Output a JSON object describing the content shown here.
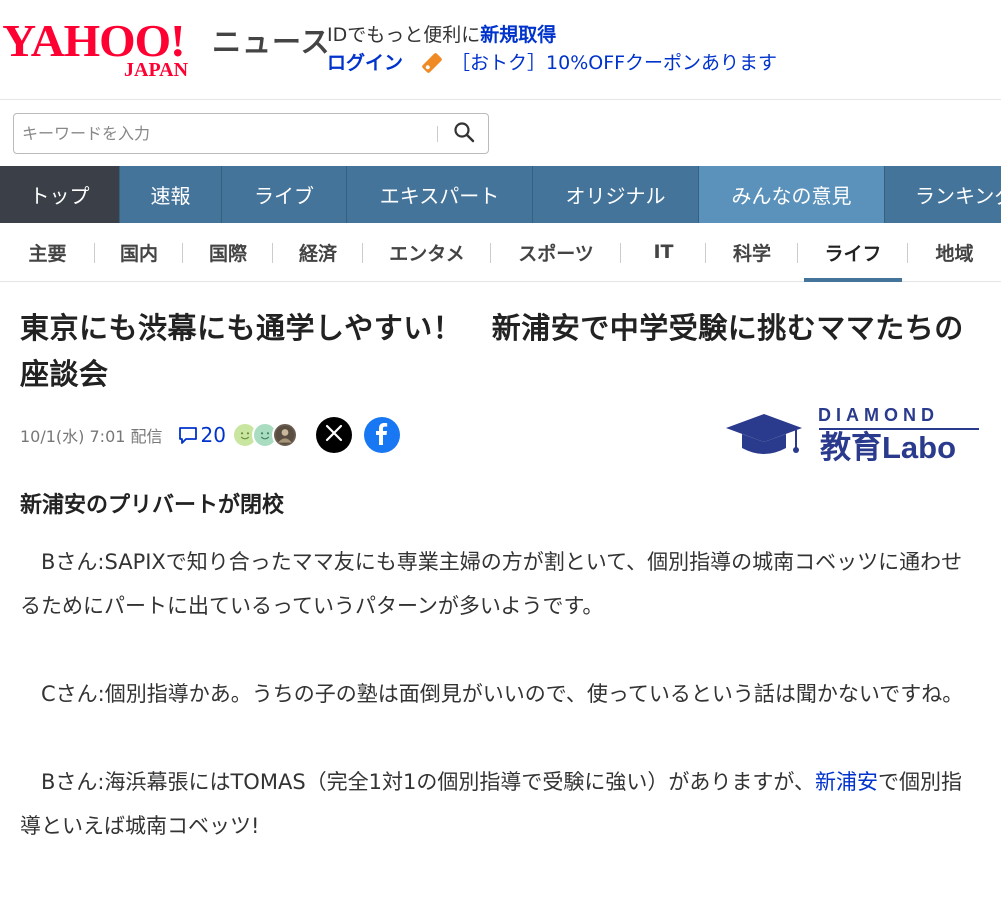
{
  "header": {
    "logo_main": "YAHOO!",
    "logo_sub": "JAPAN",
    "service_name": "ニュース",
    "promo_text": "IDでもっと便利に",
    "promo_link": "新規取得",
    "login_label": "ログイン",
    "coupon_text": "［おトク］10%OFFクーポンあります"
  },
  "search": {
    "placeholder": "キーワードを入力"
  },
  "nav_primary": [
    {
      "label": "トップ"
    },
    {
      "label": "速報"
    },
    {
      "label": "ライブ"
    },
    {
      "label": "エキスパート"
    },
    {
      "label": "オリジナル"
    },
    {
      "label": "みんなの意見"
    },
    {
      "label": "ランキング"
    }
  ],
  "nav_secondary": [
    {
      "label": "主要"
    },
    {
      "label": "国内"
    },
    {
      "label": "国際"
    },
    {
      "label": "経済"
    },
    {
      "label": "エンタメ"
    },
    {
      "label": "スポーツ"
    },
    {
      "label": "IT"
    },
    {
      "label": "科学"
    },
    {
      "label": "ライフ"
    },
    {
      "label": "地域"
    }
  ],
  "article": {
    "title": "東京にも渋幕にも通学しやすい！　新浦安で中学受験に挑むママたちの座談会",
    "date": "10/1(水) 7:01 配信",
    "comment_count": "20",
    "brand_top": "DIAMOND",
    "brand_bottom": "教育Labo",
    "section_heading": "新浦安のプリバートが閉校",
    "para1": "　Bさん:SAPIXで知り合ったママ友にも専業主婦の方が割といて、個別指導の城南コベッツに通わせるためにパートに出ているっていうパターンが多いようです。",
    "para2": "　Cさん:個別指導かあ。うちの子の塾は面倒見がいいので、使っているという話は聞かないですね。",
    "para3_before": "　Bさん:海浜幕張にはTOMAS（完全1対1の個別指導で受験に強い）がありますが、",
    "para3_link": "新浦安",
    "para3_after": "で個別指導といえば城南コベッツ!"
  },
  "colors": {
    "brand_red": "#ff0033",
    "nav_blue": "#45749b",
    "nav_active": "#3a3f48",
    "nav_highlight": "#5b92bb",
    "link_blue": "#0033cc",
    "diamond_navy": "#2a3a8c"
  }
}
